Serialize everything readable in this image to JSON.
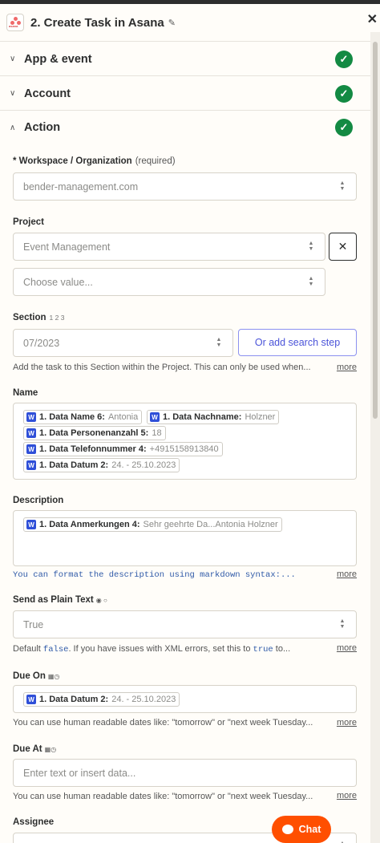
{
  "header": {
    "title": "2. Create Task in Asana",
    "logo_text": "asana"
  },
  "sections": {
    "app_event": "App & event",
    "account": "Account",
    "action": "Action"
  },
  "workspace": {
    "label": "* Workspace / Organization",
    "required": "(required)",
    "value": "bender-management.com"
  },
  "project": {
    "label": "Project",
    "value": "Event Management",
    "placeholder": "Choose value..."
  },
  "section": {
    "label": "Section",
    "hint": "1 2 3",
    "value": "07/2023",
    "search_step": "Or add search step",
    "help": "Add the task to this Section within the Project. This can only be used when...",
    "more": "more"
  },
  "name": {
    "label": "Name",
    "pills": [
      {
        "key": "1. Data Name 6:",
        "value": "Antonia"
      },
      {
        "key": "1. Data Nachname:",
        "value": "Holzner"
      },
      {
        "key": "1. Data Personenanzahl 5:",
        "value": "18"
      },
      {
        "key": "1. Data Telefonnummer 4:",
        "value": "+4915158913840"
      },
      {
        "key": "1. Data Datum 2:",
        "value": "24. - 25.10.2023"
      }
    ]
  },
  "description": {
    "label": "Description",
    "pill": {
      "key": "1. Data Anmerkungen 4:",
      "value": "Sehr geehrte Da...Antonia Holzner"
    },
    "help": "You can format the description using markdown syntax:...",
    "more": "more"
  },
  "plain_text": {
    "label": "Send as Plain Text",
    "value": "True",
    "help_prefix": "Default",
    "help_code1": "false",
    "help_mid": ". If you have issues with XML errors, set this to",
    "help_code2": "true",
    "help_suffix": "to...",
    "more": "more"
  },
  "due_on": {
    "label": "Due On",
    "pill": {
      "key": "1. Data Datum 2:",
      "value": "24. - 25.10.2023"
    },
    "help": "You can use human readable dates like: \"tomorrow\" or \"next week Tuesday...",
    "more": "more"
  },
  "due_at": {
    "label": "Due At",
    "placeholder": "Enter text or insert data...",
    "help": "You can use human readable dates like: \"tomorrow\" or \"next week Tuesday...",
    "more": "more"
  },
  "assignee": {
    "label": "Assignee"
  },
  "chat": {
    "label": "Chat"
  },
  "colors": {
    "accent": "#ff4f00",
    "success": "#138a43",
    "link": "#4a53d9"
  }
}
